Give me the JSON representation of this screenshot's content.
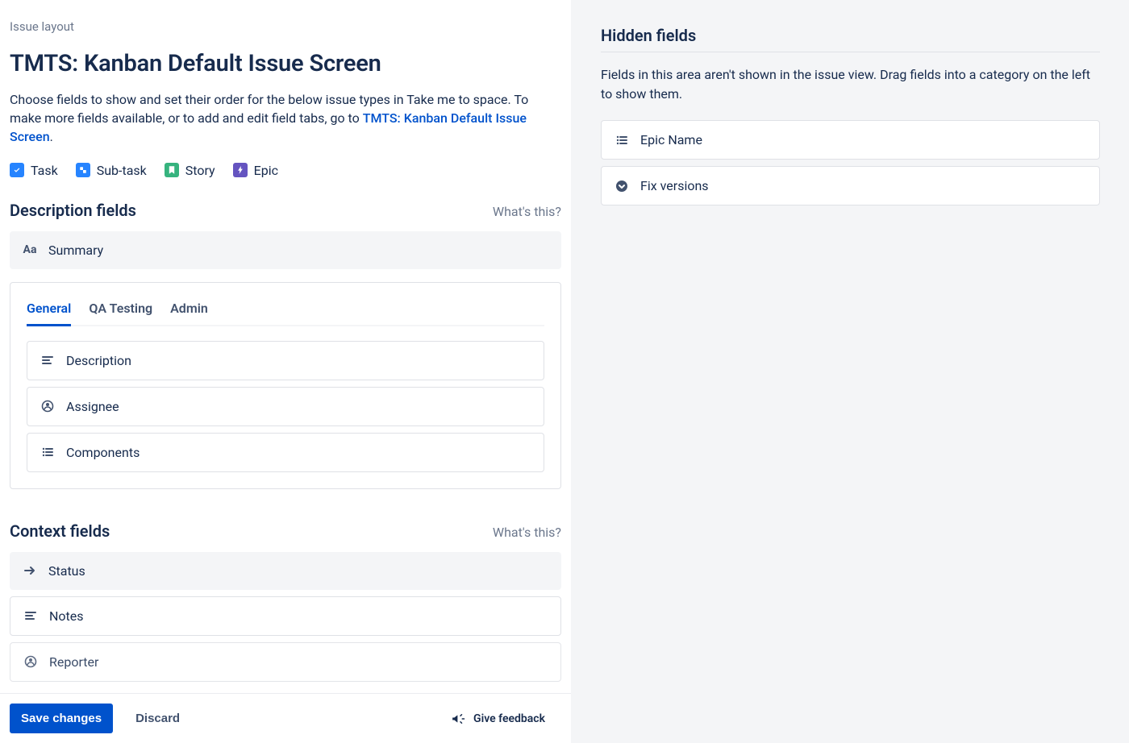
{
  "breadcrumb": "Issue layout",
  "title": "TMTS: Kanban Default Issue Screen",
  "description_prefix": "Choose fields to show and set their order for the below issue types in Take me to space. To make more fields available, or to add and edit field tabs, go to ",
  "description_link": "TMTS: Kanban Default Issue Screen",
  "description_suffix": ".",
  "issue_types": [
    {
      "label": "Task",
      "icon_bg": "#2684FF"
    },
    {
      "label": "Sub-task",
      "icon_bg": "#2684FF"
    },
    {
      "label": "Story",
      "icon_bg": "#36B37E"
    },
    {
      "label": "Epic",
      "icon_bg": "#6554C0"
    }
  ],
  "sections": {
    "description": {
      "heading": "Description fields",
      "whats_this": "What's this?",
      "summary_field": "Summary",
      "tabs": [
        "General",
        "QA Testing",
        "Admin"
      ],
      "active_tab": 0,
      "fields": [
        "Description",
        "Assignee",
        "Components"
      ]
    },
    "context": {
      "heading": "Context fields",
      "whats_this": "What's this?",
      "fields": [
        "Status",
        "Notes",
        "Reporter"
      ]
    }
  },
  "footer": {
    "save": "Save changes",
    "discard": "Discard",
    "feedback": "Give feedback"
  },
  "hidden": {
    "heading": "Hidden fields",
    "desc": "Fields in this area aren't shown in the issue view. Drag fields into a category on the left to show them.",
    "fields": [
      "Epic Name",
      "Fix versions"
    ]
  }
}
